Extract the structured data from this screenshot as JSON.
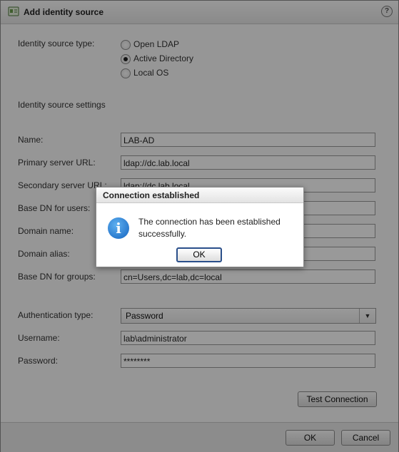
{
  "window": {
    "title": "Add identity source",
    "help_symbol": "?"
  },
  "source_type": {
    "label": "Identity source type:",
    "options": [
      {
        "label": "Open LDAP",
        "selected": false
      },
      {
        "label": "Active Directory",
        "selected": true
      },
      {
        "label": "Local OS",
        "selected": false
      }
    ]
  },
  "settings_heading": "Identity source settings",
  "fields": {
    "name": {
      "label": "Name:",
      "value": "LAB-AD"
    },
    "primary_url": {
      "label": "Primary server URL:",
      "value": "ldap://dc.lab.local"
    },
    "secondary_url": {
      "label": "Secondary server URL:",
      "value": "ldap://dc.lab.local"
    },
    "base_dn_users": {
      "label": "Base DN for users:",
      "value": ""
    },
    "domain_name": {
      "label": "Domain name:",
      "value": ""
    },
    "domain_alias": {
      "label": "Domain alias:",
      "value": ""
    },
    "base_dn_groups": {
      "label": "Base DN for groups:",
      "value": "cn=Users,dc=lab,dc=local"
    }
  },
  "auth": {
    "label": "Authentication type:",
    "selected": "Password",
    "arrow": "▼"
  },
  "username": {
    "label": "Username:",
    "value": "lab\\administrator"
  },
  "password": {
    "label": "Password:",
    "value": "********"
  },
  "test_connection_label": "Test Connection",
  "footer": {
    "ok_label": "OK",
    "cancel_label": "Cancel"
  },
  "dialog": {
    "title": "Connection established",
    "icon": "i",
    "message": "The connection has been established successfully.",
    "ok_label": "OK"
  },
  "colors": {
    "overlay": "#000000",
    "dialog_ok_border": "#2a4f8a",
    "info_icon": "#1a6fd0"
  }
}
